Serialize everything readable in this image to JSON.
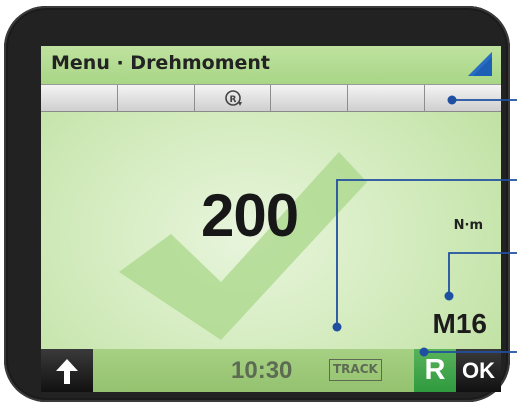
{
  "header": {
    "title": "Menu · Drehmoment",
    "corner_icon": "blue-triangle-flag-icon"
  },
  "softkeys": [
    {
      "label": "",
      "icon": null
    },
    {
      "label": "",
      "icon": null
    },
    {
      "label": "",
      "icon": "rotate-clockwise-icon"
    },
    {
      "label": "",
      "icon": null
    },
    {
      "label": "",
      "icon": null
    },
    {
      "label": "",
      "icon": null
    }
  ],
  "main": {
    "torque_value": "200",
    "unit": "N·m",
    "bolt_size": "M16",
    "status_icon": "checkmark-icon"
  },
  "bottombar": {
    "time": "10:30",
    "track_badge": "TRACK",
    "r_label": "R",
    "ok_label": "OK",
    "up_icon": "arrow-up-icon"
  },
  "colors": {
    "screen_green": "#cfe9b8",
    "header_green": "#b7de95",
    "check_green": "#a9d78a",
    "r_button_green": "#3ca44a",
    "flag_blue": "#1c5fb4",
    "callout_blue": "#1f4fa0"
  }
}
